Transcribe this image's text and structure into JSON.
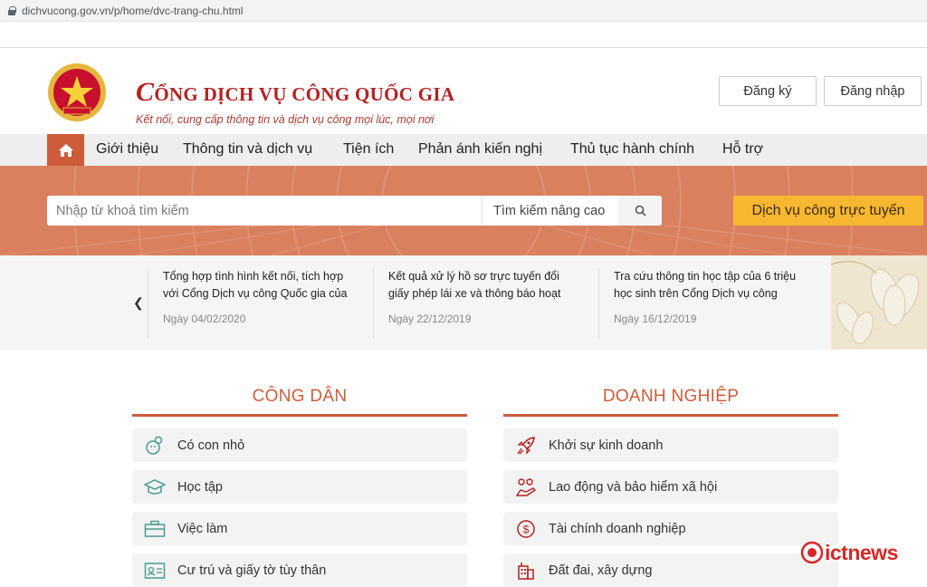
{
  "browser": {
    "url": "dichvucong.gov.vn/p/home/dvc-trang-chu.html"
  },
  "header": {
    "title": "CỔNG DỊCH VỤ CÔNG QUỐC GIA",
    "title_first": "C",
    "title_rest": "ỔNG DỊCH VỤ CÔNG QUỐC GIA",
    "subtitle": "Kết nối, cung cấp thông tin và dịch vụ công mọi lúc, mọi nơi",
    "register_label": "Đăng ký",
    "login_label": "Đăng nhập"
  },
  "nav": {
    "items": [
      "Giới thiệu",
      "Thông tin và dịch vụ",
      "Tiện ích",
      "Phản ánh kiến nghị",
      "Thủ tục hành chính",
      "Hỗ trợ"
    ]
  },
  "search": {
    "placeholder": "Nhập từ khoá tìm kiếm",
    "advanced_label": "Tìm kiếm nâng cao",
    "online_service_label": "Dịch vụ công trực tuyến"
  },
  "news": [
    {
      "title": "Tổng hợp tình hình kết nối, tích hợp với Cổng Dịch vụ công Quốc gia của Bộ,",
      "date": "Ngày 04/02/2020"
    },
    {
      "title": "Kết quả xử lý hồ sơ trực tuyến đổi giấy phép lái xe và thông báo hoạt động",
      "date": "Ngày 22/12/2019"
    },
    {
      "title": "Tra cứu thông tin học tập của 6 triệu học sinh trên Cổng Dịch vụ công quốc",
      "date": "Ngày 16/12/2019"
    }
  ],
  "citizen": {
    "title": "CÔNG DÂN",
    "items": [
      {
        "label": "Có con nhỏ",
        "icon": "baby-icon"
      },
      {
        "label": "Học tập",
        "icon": "graduation-cap-icon"
      },
      {
        "label": "Việc làm",
        "icon": "briefcase-icon"
      },
      {
        "label": "Cư trú và giấy tờ tùy thân",
        "icon": "id-card-icon"
      }
    ]
  },
  "business": {
    "title": "DOANH NGHIỆP",
    "items": [
      {
        "label": "Khởi sự kinh doanh",
        "icon": "rocket-icon"
      },
      {
        "label": "Lao động và bảo hiểm xã hội",
        "icon": "people-hand-icon"
      },
      {
        "label": "Tài chính doanh nghiệp",
        "icon": "dollar-icon"
      },
      {
        "label": "Đất đai, xây dựng",
        "icon": "building-icon"
      }
    ]
  },
  "watermark": {
    "text": "ictnews"
  },
  "colors": {
    "accent": "#cd5c3a",
    "band": "#d9805f",
    "online_button": "#f7b731",
    "brand_red": "#b22222"
  }
}
